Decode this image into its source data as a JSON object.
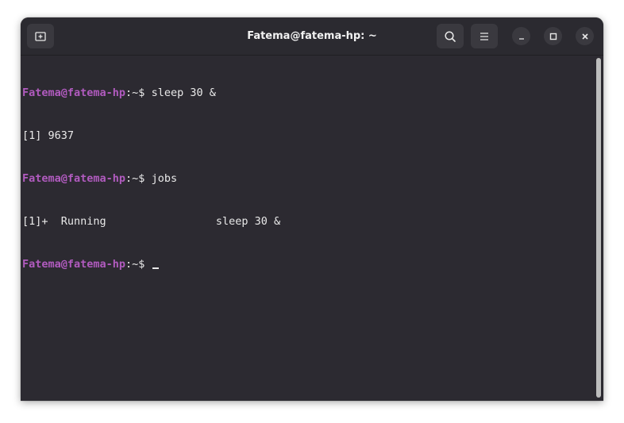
{
  "window": {
    "title": "Fatema@fatema-hp: ~"
  },
  "titlebar": {
    "new_tab_icon": "new-tab-icon",
    "search_icon": "search-icon",
    "menu_icon": "hamburger-menu-icon",
    "minimize_icon": "minimize-icon",
    "maximize_icon": "maximize-icon",
    "close_icon": "close-icon"
  },
  "terminal": {
    "prompt_user": "Fatema@fatema-hp",
    "prompt_path": ":~$ ",
    "lines": [
      {
        "type": "prompt",
        "command": "sleep 30 &"
      },
      {
        "type": "output",
        "text": "[1] 9637"
      },
      {
        "type": "prompt",
        "command": "jobs"
      },
      {
        "type": "output",
        "text": "[1]+  Running                 sleep 30 &"
      },
      {
        "type": "prompt",
        "command": ""
      }
    ]
  },
  "colors": {
    "background": "#2c2a31",
    "prompt_user": "#b15bbf",
    "text": "#e9e9e9"
  }
}
